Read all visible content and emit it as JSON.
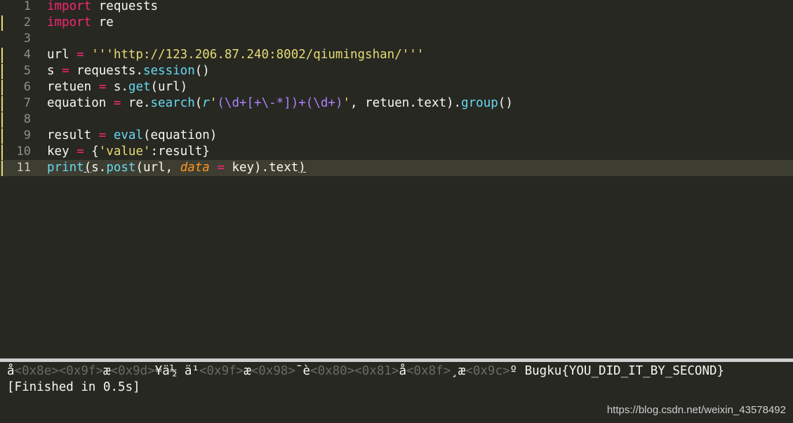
{
  "editor": {
    "line_numbers": [
      "1",
      "2",
      "3",
      "4",
      "5",
      "6",
      "7",
      "8",
      "9",
      "10",
      "11"
    ],
    "lines": [
      [
        {
          "t": "import",
          "c": "kw"
        },
        {
          "t": " requests",
          "c": "var"
        }
      ],
      [
        {
          "t": "import",
          "c": "kw"
        },
        {
          "t": " re",
          "c": "var"
        }
      ],
      [],
      [
        {
          "t": "url",
          "c": "var"
        },
        {
          "t": " = ",
          "c": "op"
        },
        {
          "t": "'''http://123.206.87.240:8002/qiumingshan/'''",
          "c": "str"
        }
      ],
      [
        {
          "t": "s",
          "c": "var"
        },
        {
          "t": " = ",
          "c": "op"
        },
        {
          "t": "requests.",
          "c": "var"
        },
        {
          "t": "session",
          "c": "fn"
        },
        {
          "t": "()",
          "c": "var"
        }
      ],
      [
        {
          "t": "retuen",
          "c": "var"
        },
        {
          "t": " = ",
          "c": "op"
        },
        {
          "t": "s.",
          "c": "var"
        },
        {
          "t": "get",
          "c": "fn"
        },
        {
          "t": "(url)",
          "c": "var"
        }
      ],
      [
        {
          "t": "equation",
          "c": "var"
        },
        {
          "t": " = ",
          "c": "op"
        },
        {
          "t": "re.",
          "c": "var"
        },
        {
          "t": "search",
          "c": "fn"
        },
        {
          "t": "(",
          "c": "var"
        },
        {
          "t": "r",
          "c": "stor"
        },
        {
          "t": "'",
          "c": "str"
        },
        {
          "t": "(\\d+[+\\-*])+(\\d+)",
          "c": "rx"
        },
        {
          "t": "'",
          "c": "str"
        },
        {
          "t": ", retuen.text).",
          "c": "var"
        },
        {
          "t": "group",
          "c": "fn"
        },
        {
          "t": "()",
          "c": "var"
        }
      ],
      [],
      [
        {
          "t": "result",
          "c": "var"
        },
        {
          "t": " = ",
          "c": "op"
        },
        {
          "t": "eval",
          "c": "fn"
        },
        {
          "t": "(equation)",
          "c": "var"
        }
      ],
      [
        {
          "t": "key",
          "c": "var"
        },
        {
          "t": " = ",
          "c": "op"
        },
        {
          "t": "{",
          "c": "var"
        },
        {
          "t": "'value'",
          "c": "str"
        },
        {
          "t": ":result}",
          "c": "var"
        }
      ],
      [
        {
          "t": "print",
          "c": "fn"
        },
        {
          "t": "(",
          "c": "var bracket"
        },
        {
          "t": "s.",
          "c": "var"
        },
        {
          "t": "post",
          "c": "fn"
        },
        {
          "t": "(url, ",
          "c": "var"
        },
        {
          "t": "data",
          "c": "param"
        },
        {
          "t": " = ",
          "c": "op"
        },
        {
          "t": "key).text",
          "c": "var"
        },
        {
          "t": ")",
          "c": "var bracket"
        }
      ]
    ],
    "active_line": 11,
    "modified_markers": [
      2,
      4,
      5,
      6,
      7,
      8,
      9,
      10,
      11
    ]
  },
  "console": {
    "output_line": [
      {
        "t": "å",
        "c": ""
      },
      {
        "t": "<0x8e><0x9f>",
        "c": "ctrl"
      },
      {
        "t": "æ",
        "c": ""
      },
      {
        "t": "<0x9d>",
        "c": "ctrl"
      },
      {
        "t": "¥ä½ ä¹",
        "c": ""
      },
      {
        "t": "<0x9f>",
        "c": "ctrl"
      },
      {
        "t": "æ",
        "c": ""
      },
      {
        "t": "<0x98>",
        "c": "ctrl"
      },
      {
        "t": "¯è",
        "c": ""
      },
      {
        "t": "<0x80><0x81>",
        "c": "ctrl"
      },
      {
        "t": "å",
        "c": ""
      },
      {
        "t": "<0x8f>",
        "c": "ctrl"
      },
      {
        "t": "¸æ",
        "c": ""
      },
      {
        "t": "<0x9c>",
        "c": "ctrl"
      },
      {
        "t": "º Bugku{YOU_DID_IT_BY_SECOND}",
        "c": ""
      }
    ],
    "finished_text": "[Finished in 0.5s]"
  },
  "watermark": "https://blog.csdn.net/weixin_43578492",
  "colors": {
    "background": "#272822",
    "keyword": "#f92672",
    "string": "#e6db74",
    "function": "#66d9ef",
    "regex": "#ae81ff",
    "parameter": "#fd971f"
  }
}
